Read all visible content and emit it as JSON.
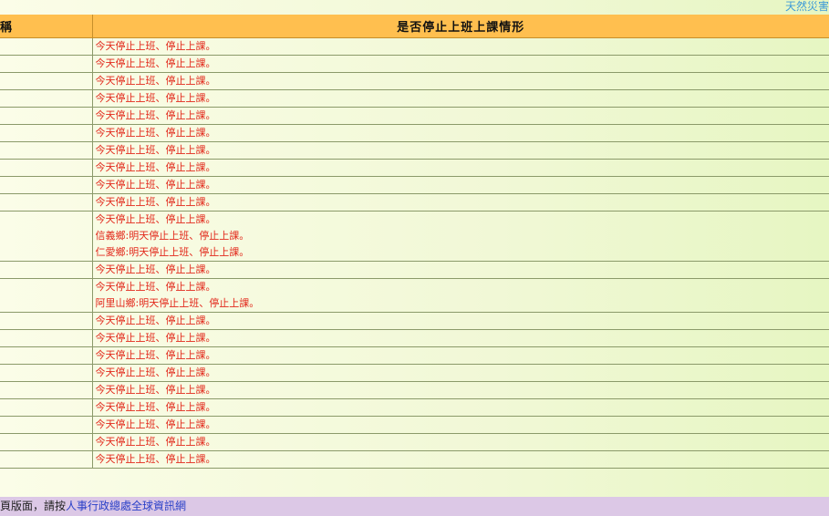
{
  "topbar": {
    "link_text": "天然災害"
  },
  "table": {
    "headers": [
      "稱",
      "是否停止上班上課情形"
    ],
    "rows": [
      {
        "name": "",
        "lines": [
          "今天停止上班、停止上課。"
        ]
      },
      {
        "name": "",
        "lines": [
          "今天停止上班、停止上課。"
        ]
      },
      {
        "name": "",
        "lines": [
          "今天停止上班、停止上課。"
        ]
      },
      {
        "name": "",
        "lines": [
          "今天停止上班、停止上課。"
        ]
      },
      {
        "name": "",
        "lines": [
          "今天停止上班、停止上課。"
        ]
      },
      {
        "name": "",
        "lines": [
          "今天停止上班、停止上課。"
        ]
      },
      {
        "name": "",
        "lines": [
          "今天停止上班、停止上課。"
        ]
      },
      {
        "name": "",
        "lines": [
          "今天停止上班、停止上課。"
        ]
      },
      {
        "name": "",
        "lines": [
          "今天停止上班、停止上課。"
        ]
      },
      {
        "name": "",
        "lines": [
          "今天停止上班、停止上課。"
        ]
      },
      {
        "name": "",
        "lines": [
          "今天停止上班、停止上課。",
          "信義鄉:明天停止上班、停止上課。",
          "仁愛鄉:明天停止上班、停止上課。"
        ]
      },
      {
        "name": "",
        "lines": [
          "今天停止上班、停止上課。"
        ]
      },
      {
        "name": "",
        "lines": [
          "今天停止上班、停止上課。",
          "阿里山鄉:明天停止上班、停止上課。"
        ]
      },
      {
        "name": "",
        "lines": [
          "今天停止上班、停止上課。"
        ]
      },
      {
        "name": "",
        "lines": [
          "今天停止上班、停止上課。"
        ]
      },
      {
        "name": "",
        "lines": [
          "今天停止上班、停止上課。"
        ]
      },
      {
        "name": "",
        "lines": [
          "今天停止上班、停止上課。"
        ]
      },
      {
        "name": "",
        "lines": [
          "今天停止上班、停止上課。"
        ]
      },
      {
        "name": "",
        "lines": [
          "今天停止上班、停止上課。"
        ]
      },
      {
        "name": "",
        "lines": [
          "今天停止上班、停止上課。"
        ]
      },
      {
        "name": "",
        "lines": [
          "今天停止上班、停止上課。"
        ]
      },
      {
        "name": "",
        "lines": [
          "今天停止上班、停止上課。"
        ]
      }
    ]
  },
  "footer": {
    "prefix": "頁版面，請按",
    "link_text": "人事行政總處全球資訊網"
  }
}
